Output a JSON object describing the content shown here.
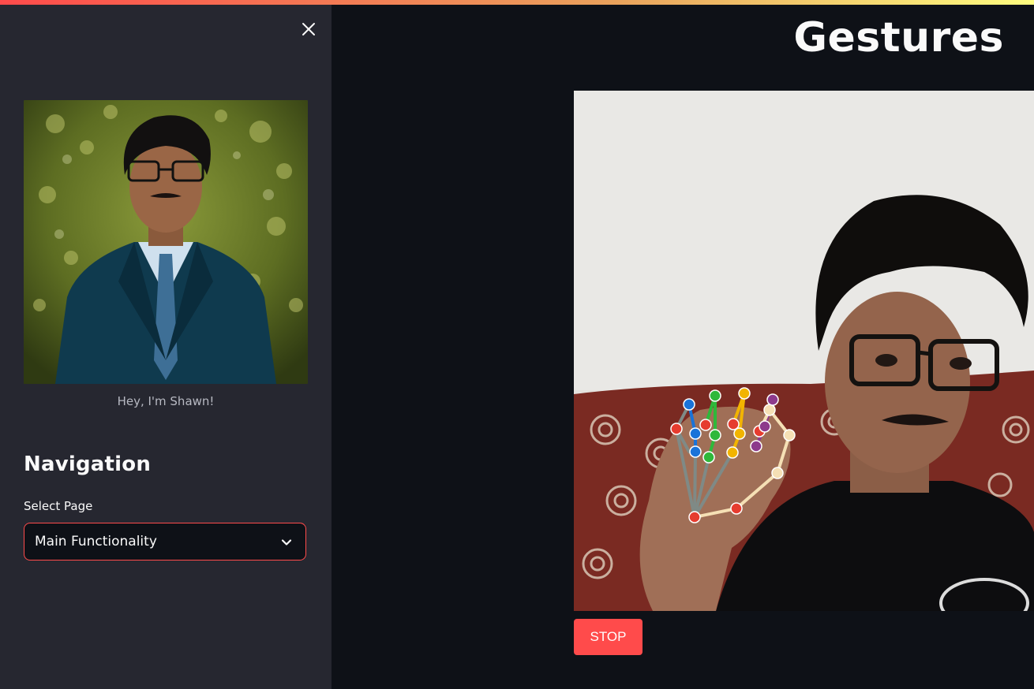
{
  "sidebar": {
    "close_icon": "close-icon",
    "profile_caption": "Hey, I'm Shawn!",
    "nav_title": "Navigation",
    "select_label": "Select Page",
    "select_value": "Main Functionality",
    "select_icon": "chevron-down-icon"
  },
  "main": {
    "heading": "Gestures",
    "stop_label": "STOP"
  },
  "colors": {
    "background": "#0e1117",
    "sidebar": "#262730",
    "accent": "#ff4b4b",
    "text": "#fafafa"
  }
}
